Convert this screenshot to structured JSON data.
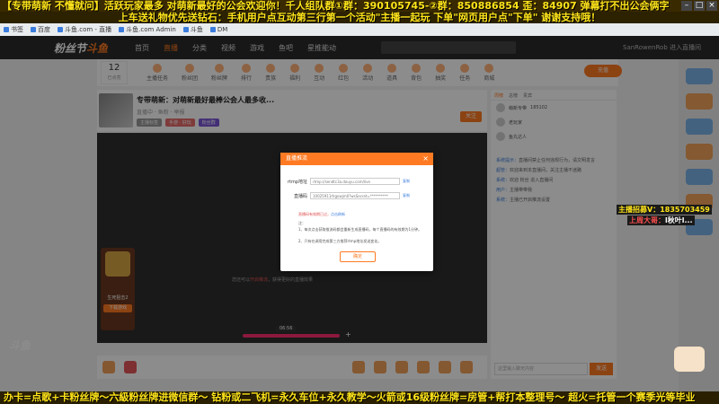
{
  "banners": {
    "top1": "【专带萌新 不懂就问】活跃玩家最多 对萌新最好的公会欢迎你！千人组队群①群：390105745-②群：850886854 歪：84907 弹幕打不出公会俩字",
    "top2": "上车送礼物优先送钻石：手机用户点互动第三行第一个活动\"主播一起玩 下单\"网页用户点\"下单\" 谢谢支持哦！",
    "bottom": "办卡=点歌+卡粉丝牌～六級粉丝牌进微信群～ 钻粉或二飞机=永久车位+永久教学～火箭或16级粉丝牌=房管+帮打本整理号～ 超火=托管一个赛季光等毕业"
  },
  "browser": {
    "bookmarks": [
      "书签",
      "百度",
      "斗鱼.com - 直播",
      "斗鱼.com Admin",
      "斗鱼",
      "DM"
    ]
  },
  "header": {
    "logo_a": "粉丝节",
    "logo_b": "斗鱼",
    "nav": [
      "首页",
      "直播",
      "分类",
      "视频",
      "游戏",
      "鱼吧",
      "星推能动"
    ],
    "active_nav": 1,
    "search_placeholder": "",
    "right_text": "SanRowenRob  进入直播间"
  },
  "toolbar": {
    "level": "12",
    "level_sub": "已点亮",
    "items": [
      "主播任务",
      "粉丝团",
      "粉丝牌",
      "排行",
      "贵族",
      "福利",
      "互动",
      "红包",
      "活动",
      "道具",
      "背包",
      "抽奖",
      "任务",
      "商城"
    ],
    "charge": "充值"
  },
  "room": {
    "title": "专带萌新：对萌新最好最棒公会人最多收...",
    "sub": "直播中 · 鱼粉 · 举报",
    "tags": [
      "主播标签",
      "手游 · 好玩",
      "粉丝群"
    ],
    "follow": "关注"
  },
  "video": {
    "hint_a": "您还可以",
    "hint_b": "开启推流",
    "hint_c": "，获得更好的直播效果",
    "time": "06:56",
    "plus": "+"
  },
  "gift_panel": {
    "name": "生死狙击2",
    "button": "下载游戏"
  },
  "watermark": "斗鱼",
  "right_col": {
    "tabs": [
      "周榜",
      "总榜",
      "贵宾"
    ],
    "active_tab": 0,
    "rank": [
      {
        "name": "萌新专带",
        "value": "185102"
      },
      {
        "name": "老玩家",
        "value": ""
      },
      {
        "name": "鱼丸达人",
        "value": ""
      }
    ],
    "chat": [
      {
        "name": "系统提示：",
        "text": "直播间禁止任何违规行为，请文明发言"
      },
      {
        "name": "超管：",
        "text": "欢迎来到本直播间，关注主播不迷路"
      },
      {
        "name": "系统：",
        "text": "欢迎 粉丝 进入直播间"
      },
      {
        "name": "用户：",
        "text": "主播带带我"
      },
      {
        "name": "系统：",
        "text": "主播已开启推流设置"
      }
    ],
    "input_placeholder": "这里输入聊天内容",
    "send": "发送"
  },
  "overlays": {
    "recruit_label": "主播招募V：",
    "recruit_value": "1835703459",
    "week_label": "上周大哥：",
    "week_value": "l秋叶l..."
  },
  "modal": {
    "title": "直播推流",
    "close": "×",
    "rtmp_label": "rtmp地址",
    "rtmp_value": "rtmp://sendtc3a.douyu.com/live",
    "code_label": "直播码",
    "code_value": "10025911rhgowjm0?wsSecret=**********",
    "copy": "复制",
    "warn": "直播码有效期已过，",
    "warn_link": "点击刷新",
    "note_title": "注：",
    "notes": [
      "1、每次点击获取推流码都会重新生成直播码，每个直播码的有效期为1分钟。",
      "2、只有在调用完成第三方推荐rtmp地址发送变化。"
    ],
    "confirm": "确定"
  }
}
